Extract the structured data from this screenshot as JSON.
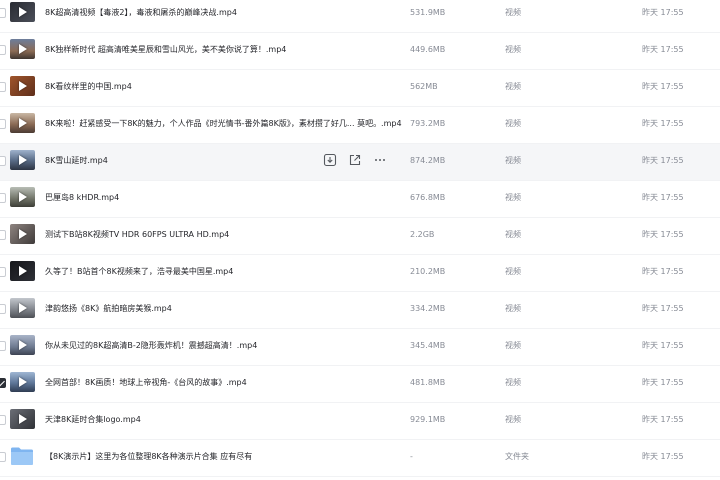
{
  "files": [
    {
      "name": "8K超高清视频【毒液2】，毒液和屠杀的巅峰决战.mp4",
      "size": "531.9MB",
      "type": "视频",
      "time": "昨天 17:55",
      "thumb": "#3d4048"
    },
    {
      "name": "8K独样新时代 超高清唯美星辰和雪山风光，美不美你说了算！.mp4",
      "size": "449.6MB",
      "type": "视频",
      "time": "昨天 17:55",
      "thumb": "#6b5a4e"
    },
    {
      "name": "8K看纹样里的中国.mp4",
      "size": "562MB",
      "type": "视频",
      "time": "昨天 17:55",
      "thumb": "#8a4b2e"
    },
    {
      "name": "8K来啦！赶紧感受一下8K的魅力，个人作品《时光情书-番外篇8K版》，素材攒了好几... 莫吧。.mp4",
      "size": "793.2MB",
      "type": "视频",
      "time": "昨天 17:55",
      "thumb": "#a98b76"
    },
    {
      "name": "8K雪山延时.mp4",
      "size": "874.2MB",
      "type": "视频",
      "time": "昨天 17:55",
      "thumb": "#5d6b80"
    },
    {
      "name": "巴厘岛8 kHDR.mp4",
      "size": "676.8MB",
      "type": "视频",
      "time": "昨天 17:55",
      "thumb": "#7a7c72"
    },
    {
      "name": "测试下B站8K视频TV HDR 60FPS ULTRA HD.mp4",
      "size": "2.2GB",
      "type": "视频",
      "time": "昨天 17:55",
      "thumb": "#6e6a68"
    },
    {
      "name": "久等了！B站首个8K视频来了，浩寻最美中国星.mp4",
      "size": "210.2MB",
      "type": "视频",
      "time": "昨天 17:55",
      "thumb": "#1f2025"
    },
    {
      "name": "津韵悠扬《8K》航拍暗房美猴.mp4",
      "size": "334.2MB",
      "type": "视频",
      "time": "昨天 17:55",
      "thumb": "#8d9096"
    },
    {
      "name": "你从未见过的8K超高清B-2隐形轰炸机！震撼超高清！.mp4",
      "size": "345.4MB",
      "type": "视频",
      "time": "昨天 17:55",
      "thumb": "#7c8699"
    },
    {
      "name": "全网首部！8K画质！地球上帝视角-《台风的故事》.mp4",
      "size": "481.8MB",
      "type": "视频",
      "time": "昨天 17:55",
      "thumb": "#6f86a3"
    },
    {
      "name": "天津8K延时合集logo.mp4",
      "size": "929.1MB",
      "type": "视频",
      "time": "昨天 17:55",
      "thumb": "#55585f"
    },
    {
      "name": "【8K演示片】这里为各位整理8K各种演示片合集 应有尽有",
      "size": "-",
      "type": "文件夹",
      "time": "昨天 17:55",
      "thumb": ""
    }
  ],
  "icons": {
    "download": "download-icon",
    "share": "share-icon",
    "more": "more-icon",
    "play": "play-icon",
    "folder": "folder-icon"
  },
  "colors": {
    "text": "#25262b",
    "meta": "#878b95",
    "hover": "#f5f6f8",
    "folder": "#7fb5f0"
  }
}
